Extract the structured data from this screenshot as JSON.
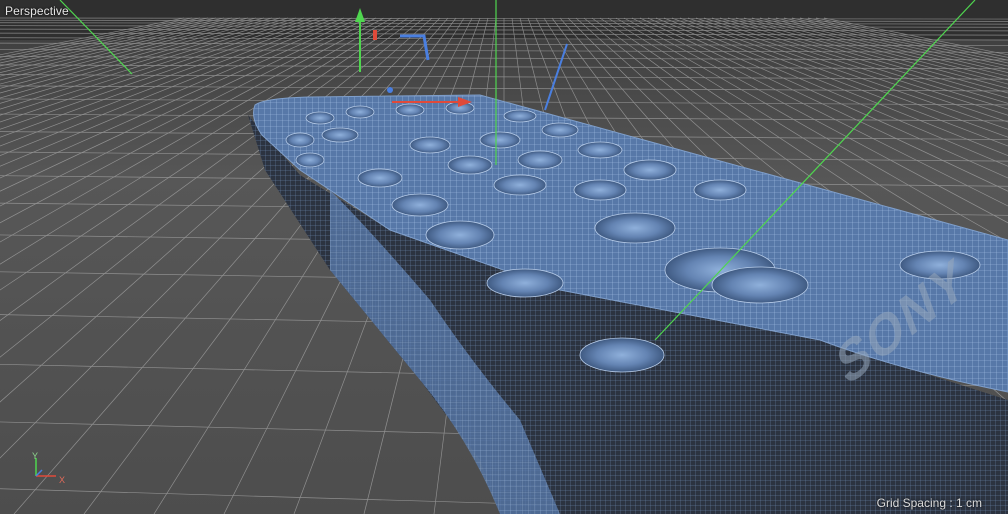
{
  "viewport": {
    "title": "Perspective",
    "grid_spacing": "Grid Spacing : 1 cm",
    "brand_text": "SONY"
  },
  "axis_widget": {
    "y_label": "Y",
    "x_label": "X",
    "z_label": "Z"
  },
  "colors": {
    "background": "#4a4a4a",
    "grid_line": "#9a9a9a",
    "mesh_fill": "#5d7fae",
    "mesh_wire": "#a9c3e6",
    "axis_x": "#e04a3a",
    "axis_y": "#4fd64f",
    "axis_z": "#4a7fe0"
  },
  "icons": [
    "move-gizmo-icon",
    "axis-orientation-icon"
  ]
}
